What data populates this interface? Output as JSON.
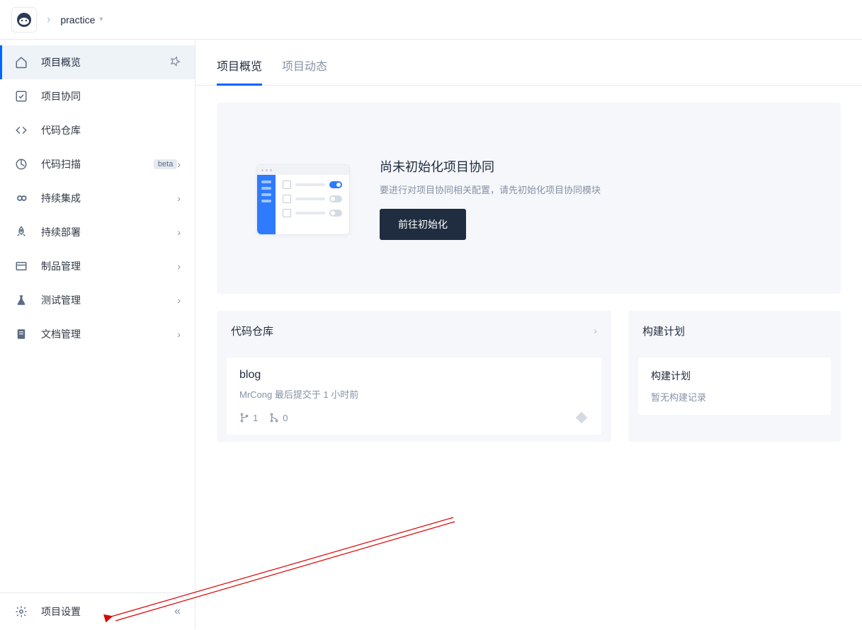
{
  "breadcrumb": {
    "project": "practice"
  },
  "sidebar": {
    "items": [
      {
        "label": "项目概览",
        "icon": "home",
        "badge": "",
        "active": true,
        "pinned": true
      },
      {
        "label": "项目协同",
        "icon": "checkbox",
        "badge": "",
        "chevron": false
      },
      {
        "label": "代码仓库",
        "icon": "code",
        "badge": "",
        "chevron": false
      },
      {
        "label": "代码扫描",
        "icon": "scan",
        "badge": "beta",
        "chevron": true
      },
      {
        "label": "持续集成",
        "icon": "infinity",
        "badge": "",
        "chevron": true
      },
      {
        "label": "持续部署",
        "icon": "rocket",
        "badge": "",
        "chevron": true
      },
      {
        "label": "制品管理",
        "icon": "package",
        "badge": "",
        "chevron": true
      },
      {
        "label": "测试管理",
        "icon": "flask",
        "badge": "",
        "chevron": true
      },
      {
        "label": "文档管理",
        "icon": "doc",
        "badge": "",
        "chevron": true
      }
    ],
    "settings_label": "项目设置"
  },
  "tabs": {
    "overview": "项目概览",
    "activity": "项目动态"
  },
  "init": {
    "title": "尚未初始化项目协同",
    "desc": "要进行对项目协同相关配置，请先初始化项目协同模块",
    "button": "前往初始化"
  },
  "repo_panel": {
    "title": "代码仓库",
    "repo": {
      "name": "blog",
      "meta": "MrCong 最后提交于 1 小时前",
      "branches": "1",
      "merges": "0"
    }
  },
  "build_panel": {
    "title": "构建计划",
    "card_title": "构建计划",
    "empty": "暂无构建记录"
  }
}
